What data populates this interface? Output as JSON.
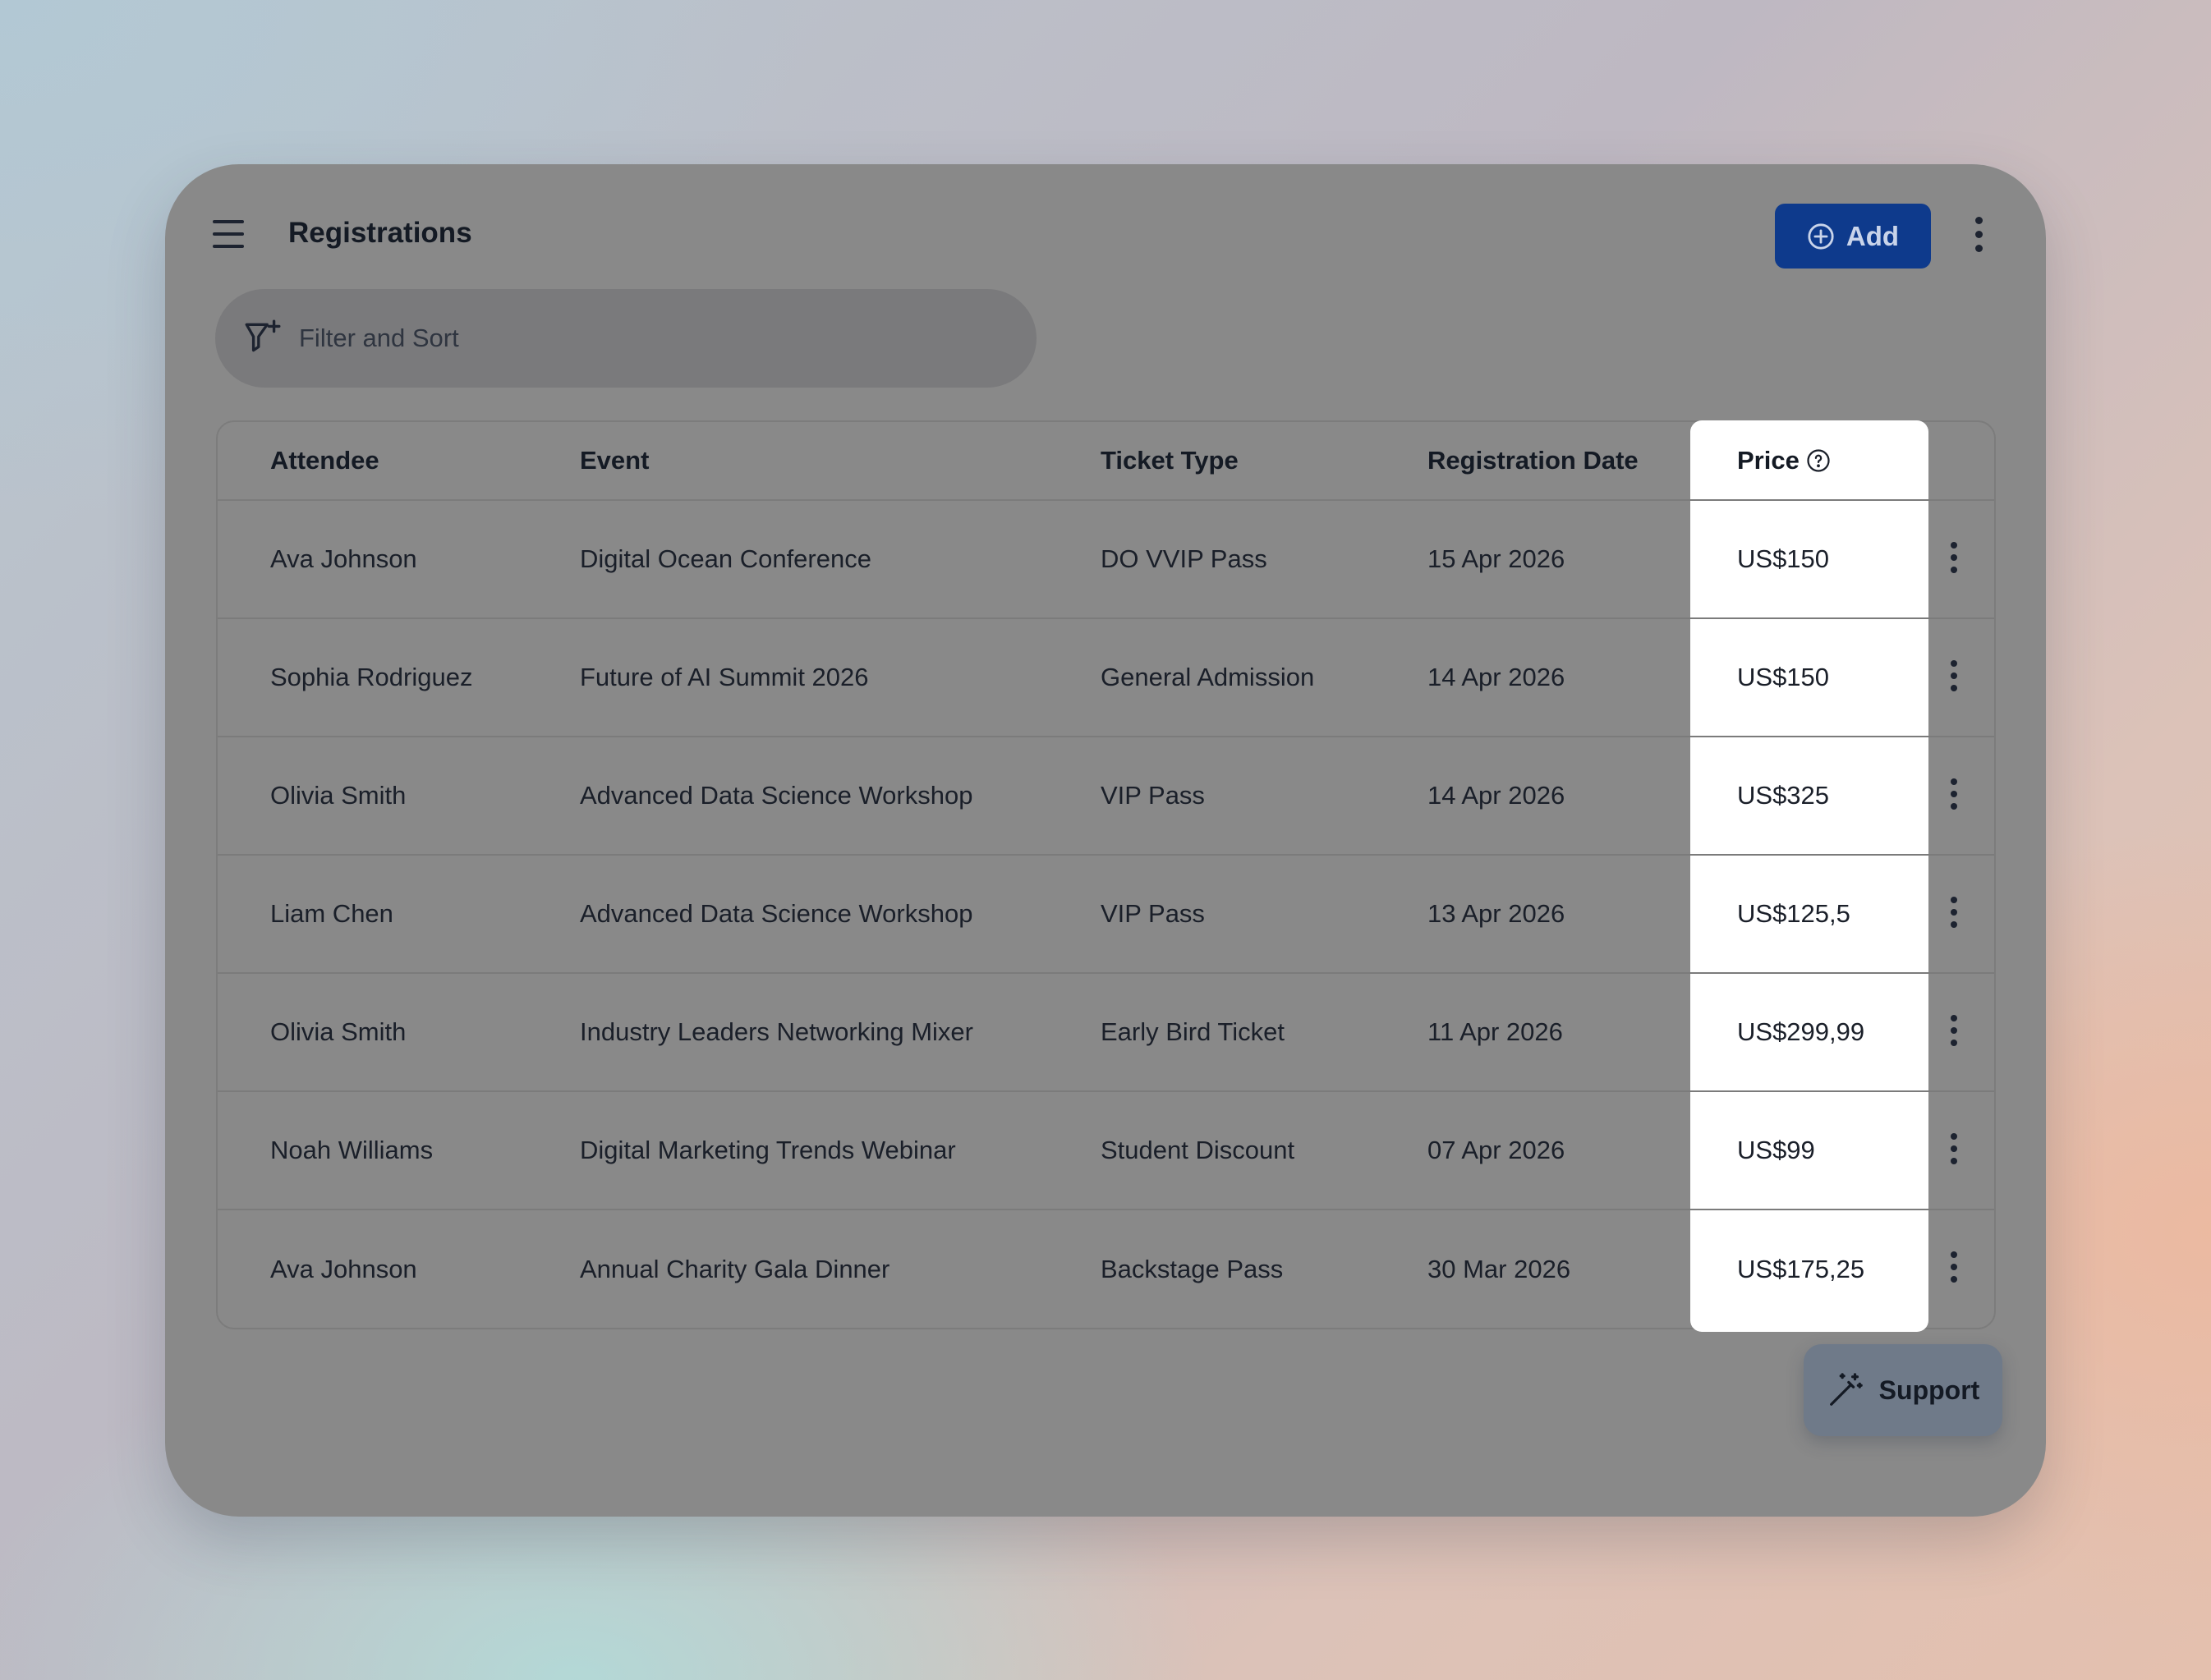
{
  "header": {
    "title": "Registrations",
    "add_label": "Add",
    "menu_icon": "hamburger-menu-icon",
    "more_icon": "more-vertical-icon"
  },
  "filter": {
    "placeholder": "Filter and Sort",
    "icon": "filter-plus-icon"
  },
  "table": {
    "columns": [
      "Attendee",
      "Event",
      "Ticket Type",
      "Registration Date",
      "Price"
    ],
    "rows": [
      {
        "attendee": "Ava Johnson",
        "event": "Digital Ocean Conference",
        "ticket": "DO VVIP Pass",
        "date": "15 Apr 2026",
        "price": "US$150"
      },
      {
        "attendee": "Sophia Rodriguez",
        "event": "Future of AI Summit 2026",
        "ticket": "General Admission",
        "date": "14 Apr 2026",
        "price": "US$150"
      },
      {
        "attendee": "Olivia Smith",
        "event": "Advanced Data Science Workshop",
        "ticket": "VIP Pass",
        "date": "14 Apr 2026",
        "price": "US$325"
      },
      {
        "attendee": "Liam Chen",
        "event": "Advanced Data Science Workshop",
        "ticket": "VIP Pass",
        "date": "13 Apr 2026",
        "price": "US$125,5"
      },
      {
        "attendee": "Olivia Smith",
        "event": "Industry Leaders Networking Mixer",
        "ticket": "Early Bird Ticket",
        "date": "11 Apr 2026",
        "price": "US$299,99"
      },
      {
        "attendee": "Noah Williams",
        "event": "Digital Marketing Trends Webinar",
        "ticket": "Student Discount",
        "date": "07 Apr 2026",
        "price": "US$99"
      },
      {
        "attendee": "Ava Johnson",
        "event": "Annual Charity Gala Dinner",
        "ticket": "Backstage Pass",
        "date": "30 Mar 2026",
        "price": "US$175,25"
      }
    ]
  },
  "support": {
    "label": "Support",
    "icon": "magic-wand-icon"
  },
  "colors": {
    "primary": "#0e3a8c",
    "highlight_column": "#ffffff",
    "overlay": "#898989"
  }
}
